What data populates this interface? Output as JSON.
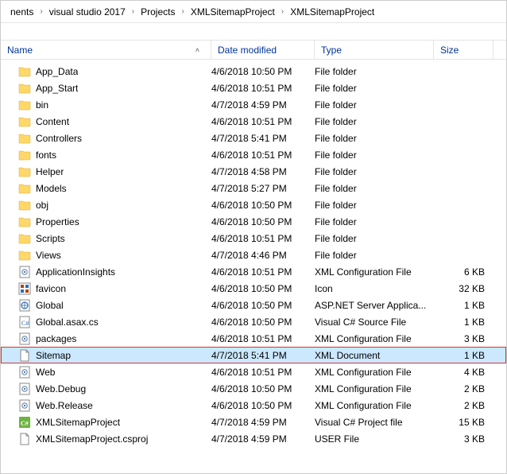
{
  "breadcrumb": {
    "items": [
      "nents",
      "visual studio 2017",
      "Projects",
      "XMLSitemapProject",
      "XMLSitemapProject"
    ]
  },
  "columns": {
    "name": "Name",
    "date": "Date modified",
    "type": "Type",
    "size": "Size"
  },
  "files": [
    {
      "icon": "folder",
      "name": "App_Data",
      "date": "4/6/2018 10:50 PM",
      "type": "File folder",
      "size": ""
    },
    {
      "icon": "folder",
      "name": "App_Start",
      "date": "4/6/2018 10:51 PM",
      "type": "File folder",
      "size": ""
    },
    {
      "icon": "folder",
      "name": "bin",
      "date": "4/7/2018 4:59 PM",
      "type": "File folder",
      "size": ""
    },
    {
      "icon": "folder",
      "name": "Content",
      "date": "4/6/2018 10:51 PM",
      "type": "File folder",
      "size": ""
    },
    {
      "icon": "folder",
      "name": "Controllers",
      "date": "4/7/2018 5:41 PM",
      "type": "File folder",
      "size": ""
    },
    {
      "icon": "folder",
      "name": "fonts",
      "date": "4/6/2018 10:51 PM",
      "type": "File folder",
      "size": ""
    },
    {
      "icon": "folder",
      "name": "Helper",
      "date": "4/7/2018 4:58 PM",
      "type": "File folder",
      "size": ""
    },
    {
      "icon": "folder",
      "name": "Models",
      "date": "4/7/2018 5:27 PM",
      "type": "File folder",
      "size": ""
    },
    {
      "icon": "folder",
      "name": "obj",
      "date": "4/6/2018 10:50 PM",
      "type": "File folder",
      "size": ""
    },
    {
      "icon": "folder",
      "name": "Properties",
      "date": "4/6/2018 10:50 PM",
      "type": "File folder",
      "size": ""
    },
    {
      "icon": "folder",
      "name": "Scripts",
      "date": "4/6/2018 10:51 PM",
      "type": "File folder",
      "size": ""
    },
    {
      "icon": "folder",
      "name": "Views",
      "date": "4/7/2018 4:46 PM",
      "type": "File folder",
      "size": ""
    },
    {
      "icon": "config",
      "name": "ApplicationInsights",
      "date": "4/6/2018 10:51 PM",
      "type": "XML Configuration File",
      "size": "6 KB"
    },
    {
      "icon": "favicon",
      "name": "favicon",
      "date": "4/6/2018 10:50 PM",
      "type": "Icon",
      "size": "32 KB"
    },
    {
      "icon": "asax",
      "name": "Global",
      "date": "4/6/2018 10:50 PM",
      "type": "ASP.NET Server Applica...",
      "size": "1 KB"
    },
    {
      "icon": "cs",
      "name": "Global.asax.cs",
      "date": "4/6/2018 10:50 PM",
      "type": "Visual C# Source File",
      "size": "1 KB"
    },
    {
      "icon": "config",
      "name": "packages",
      "date": "4/6/2018 10:51 PM",
      "type": "XML Configuration File",
      "size": "3 KB"
    },
    {
      "icon": "file",
      "name": "Sitemap",
      "date": "4/7/2018 5:41 PM",
      "type": "XML Document",
      "size": "1 KB",
      "selected": true,
      "highlighted": true
    },
    {
      "icon": "config",
      "name": "Web",
      "date": "4/6/2018 10:51 PM",
      "type": "XML Configuration File",
      "size": "4 KB"
    },
    {
      "icon": "config",
      "name": "Web.Debug",
      "date": "4/6/2018 10:50 PM",
      "type": "XML Configuration File",
      "size": "2 KB"
    },
    {
      "icon": "config",
      "name": "Web.Release",
      "date": "4/6/2018 10:50 PM",
      "type": "XML Configuration File",
      "size": "2 KB"
    },
    {
      "icon": "csproj",
      "name": "XMLSitemapProject",
      "date": "4/7/2018 4:59 PM",
      "type": "Visual C# Project file",
      "size": "15 KB"
    },
    {
      "icon": "file",
      "name": "XMLSitemapProject.csproj",
      "date": "4/7/2018 4:59 PM",
      "type": "USER File",
      "size": "3 KB"
    }
  ]
}
